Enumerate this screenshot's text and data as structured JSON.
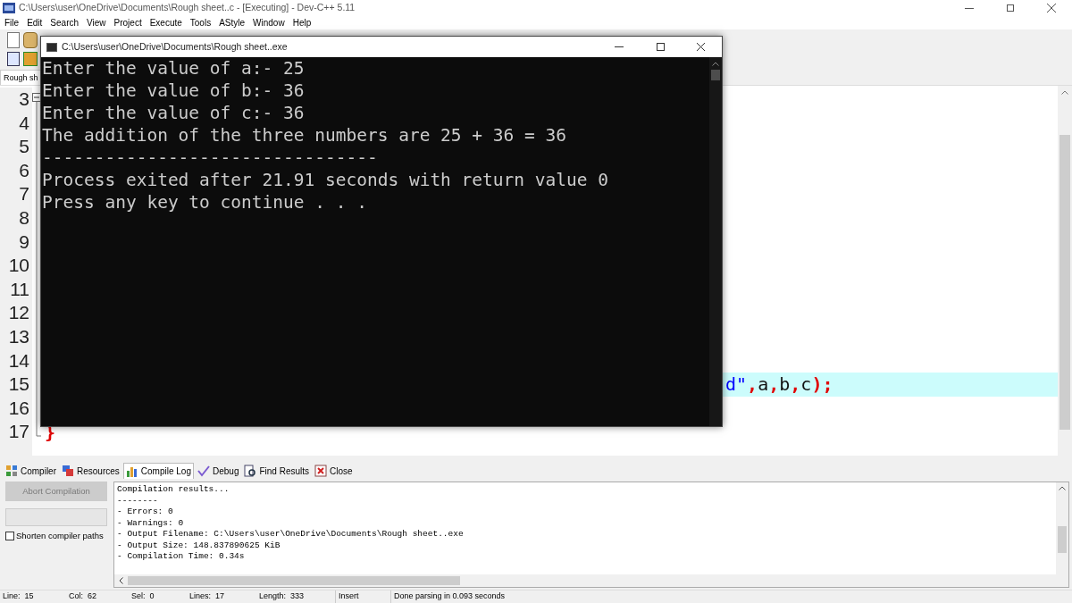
{
  "window": {
    "title": "C:\\Users\\user\\OneDrive\\Documents\\Rough sheet..c - [Executing] - Dev-C++ 5.11"
  },
  "menu": [
    "File",
    "Edit",
    "Search",
    "View",
    "Project",
    "Execute",
    "Tools",
    "AStyle",
    "Window",
    "Help"
  ],
  "editor_tab": {
    "label": "Rough sh"
  },
  "editor": {
    "lines": [
      {
        "number": "3",
        "highlighted": false
      },
      {
        "number": "4",
        "highlighted": false
      },
      {
        "number": "5",
        "highlighted": false
      },
      {
        "number": "6",
        "highlighted": false
      },
      {
        "number": "7",
        "highlighted": false
      },
      {
        "number": "8",
        "highlighted": false
      },
      {
        "number": "9",
        "highlighted": false
      },
      {
        "number": "10",
        "highlighted": false
      },
      {
        "number": "11",
        "highlighted": false
      },
      {
        "number": "12",
        "highlighted": false
      },
      {
        "number": "13",
        "highlighted": false
      },
      {
        "number": "14",
        "highlighted": false
      },
      {
        "number": "15",
        "highlighted": true,
        "tokens": [
          {
            "kind": "string",
            "text": "d\""
          },
          {
            "kind": "symbol",
            "text": ","
          },
          {
            "kind": "ident",
            "text": "a"
          },
          {
            "kind": "symbol",
            "text": ","
          },
          {
            "kind": "ident",
            "text": "b"
          },
          {
            "kind": "symbol",
            "text": ","
          },
          {
            "kind": "ident",
            "text": "c"
          },
          {
            "kind": "symbol",
            "text": ");"
          }
        ]
      },
      {
        "number": "16",
        "highlighted": false
      },
      {
        "number": "17",
        "highlighted": false,
        "tokens": [
          {
            "kind": "symbol",
            "text": "}"
          }
        ]
      }
    ]
  },
  "console": {
    "title": "C:\\Users\\user\\OneDrive\\Documents\\Rough sheet..exe",
    "lines": [
      "Enter the value of a:- 25",
      "Enter the value of b:- 36",
      "Enter the value of c:- 36",
      "The addition of the three numbers are 25 + 36 = 36",
      "--------------------------------",
      "Process exited after 21.91 seconds with return value 0",
      "Press any key to continue . . ."
    ]
  },
  "bottom_tabs": [
    {
      "label": "Compiler",
      "selected": false
    },
    {
      "label": "Resources",
      "selected": false
    },
    {
      "label": "Compile Log",
      "selected": true
    },
    {
      "label": "Debug",
      "selected": false
    },
    {
      "label": "Find Results",
      "selected": false
    },
    {
      "label": "Close",
      "selected": false
    }
  ],
  "abort_button": {
    "label": "Abort Compilation",
    "disabled": true
  },
  "shorten_paths": {
    "label": "Shorten compiler paths",
    "checked": false
  },
  "compile_log": [
    "Compilation results...",
    "--------",
    "- Errors: 0",
    "- Warnings: 0",
    "- Output Filename: C:\\Users\\user\\OneDrive\\Documents\\Rough sheet..exe",
    "- Output Size: 148.837890625 KiB",
    "- Compilation Time: 0.34s"
  ],
  "status_bar": {
    "fields": [
      {
        "label": "Line:",
        "value": "15"
      },
      {
        "label": "Col:",
        "value": "62"
      },
      {
        "label": "Sel:",
        "value": "0"
      },
      {
        "label": "Lines:",
        "value": "17"
      },
      {
        "label": "Length:",
        "value": "333"
      }
    ],
    "mode": "Insert",
    "message": "Done parsing in 0.093 seconds"
  }
}
